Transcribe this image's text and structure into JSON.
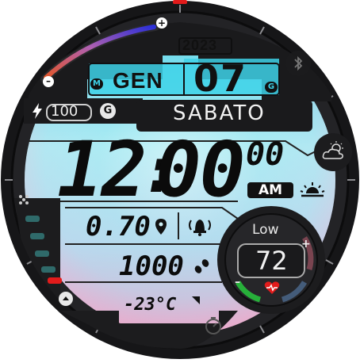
{
  "date": {
    "year": "2023",
    "month": "GEN",
    "month_badge": "M",
    "day": "07",
    "day_badge": "G",
    "weekday": "SABATO"
  },
  "battery": {
    "value": "100",
    "badge": "G",
    "level": 1.0
  },
  "time": {
    "hours": "12",
    "minutes": "00",
    "seconds": "00",
    "ampm": "AM"
  },
  "stats": {
    "distance": "0.70",
    "steps": "1000",
    "temperature": "-23°C"
  },
  "heart_rate": {
    "zone_label": "Low",
    "value": "72",
    "plus": "+",
    "minus": "–"
  },
  "buttons": {
    "top_plus": "+",
    "side_minus": "–"
  },
  "icons": {
    "bolt": "lightning-icon",
    "bluetooth": "bluetooth-icon",
    "weather": "weather-partly-cloudy-icon",
    "sunrise": "sunrise-icon",
    "location": "location-pin-icon",
    "alarm": "alarm-bell-icon",
    "steps": "footsteps-icon",
    "heart": "heart-pulse-icon",
    "timer": "timer-icon",
    "apps": "apps-grid-icon",
    "arrow_up": "arrow-up-icon"
  },
  "colors": {
    "lcd_top": "#3fd6ea",
    "lcd_mid": "#bfeef5",
    "lcd_bottom": "#f0a8c8",
    "bezel": "#1b1b1d",
    "accent_red": "#e21b1b"
  }
}
